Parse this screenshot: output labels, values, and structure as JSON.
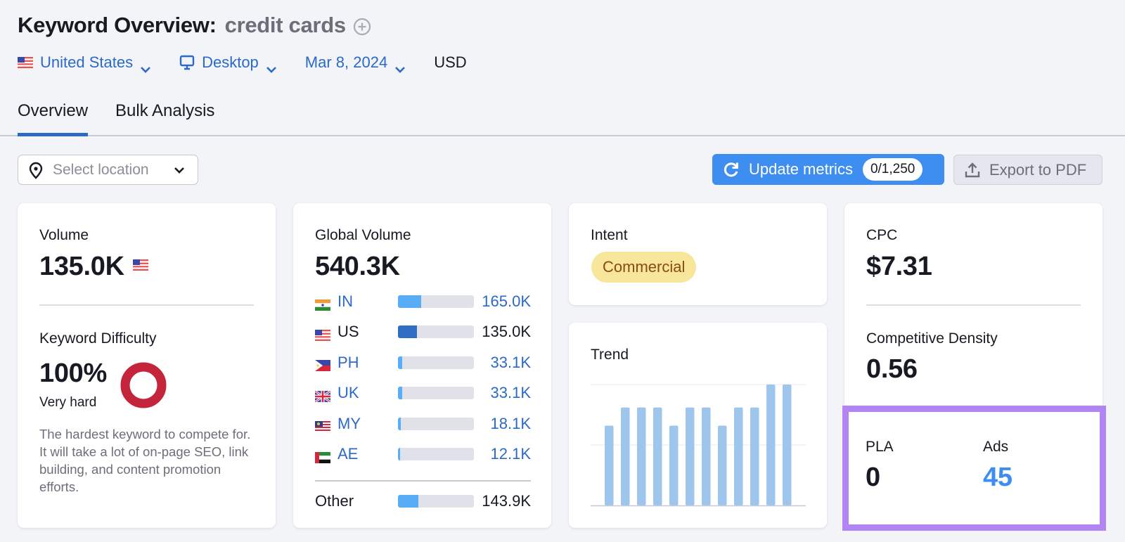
{
  "header": {
    "title": "Keyword Overview:",
    "keyword": "credit cards",
    "add_icon": "plus-circle-icon"
  },
  "filters": {
    "country": "United States",
    "country_flag": "us-flag-icon",
    "device": "Desktop",
    "device_icon": "desktop-icon",
    "date": "Mar 8, 2024",
    "currency": "USD"
  },
  "tabs": [
    {
      "label": "Overview",
      "active": true
    },
    {
      "label": "Bulk Analysis",
      "active": false
    }
  ],
  "toolbar": {
    "location_placeholder": "Select location",
    "update_label": "Update metrics",
    "update_count": "0/1,250",
    "export_label": "Export to PDF"
  },
  "volume": {
    "label": "Volume",
    "value": "135.0K"
  },
  "difficulty": {
    "label": "Keyword Difficulty",
    "value": "100%",
    "percent": 100,
    "level": "Very hard",
    "description": "The hardest keyword to compete for. It will take a lot of on-page SEO, link building, and content promotion efforts.",
    "color": "#c4253a"
  },
  "global_volume": {
    "label": "Global Volume",
    "value": "540.3K",
    "rows": [
      {
        "code": "IN",
        "value": "165.0K",
        "share": 0.31,
        "highlight": false
      },
      {
        "code": "US",
        "value": "135.0K",
        "share": 0.25,
        "highlight": true
      },
      {
        "code": "PH",
        "value": "33.1K",
        "share": 0.06,
        "highlight": false
      },
      {
        "code": "UK",
        "value": "33.1K",
        "share": 0.06,
        "highlight": false
      },
      {
        "code": "MY",
        "value": "18.1K",
        "share": 0.04,
        "highlight": false
      },
      {
        "code": "AE",
        "value": "12.1K",
        "share": 0.03,
        "highlight": false
      }
    ],
    "other": {
      "label": "Other",
      "value": "143.9K",
      "share": 0.27
    }
  },
  "intent": {
    "label": "Intent",
    "value": "Commercial"
  },
  "trend": {
    "label": "Trend",
    "values": [
      0.66,
      0.81,
      0.81,
      0.81,
      0.66,
      0.81,
      0.81,
      0.66,
      0.81,
      0.81,
      1.0,
      1.0
    ],
    "bar_color": "#9ec6ec"
  },
  "cpc": {
    "label": "CPC",
    "value": "$7.31"
  },
  "competitive_density": {
    "label": "Competitive Density",
    "value": "0.56"
  },
  "serp_ads": {
    "pla_label": "PLA",
    "pla_value": "0",
    "ads_label": "Ads",
    "ads_value": "45",
    "highlight_color": "#b284f4"
  }
}
